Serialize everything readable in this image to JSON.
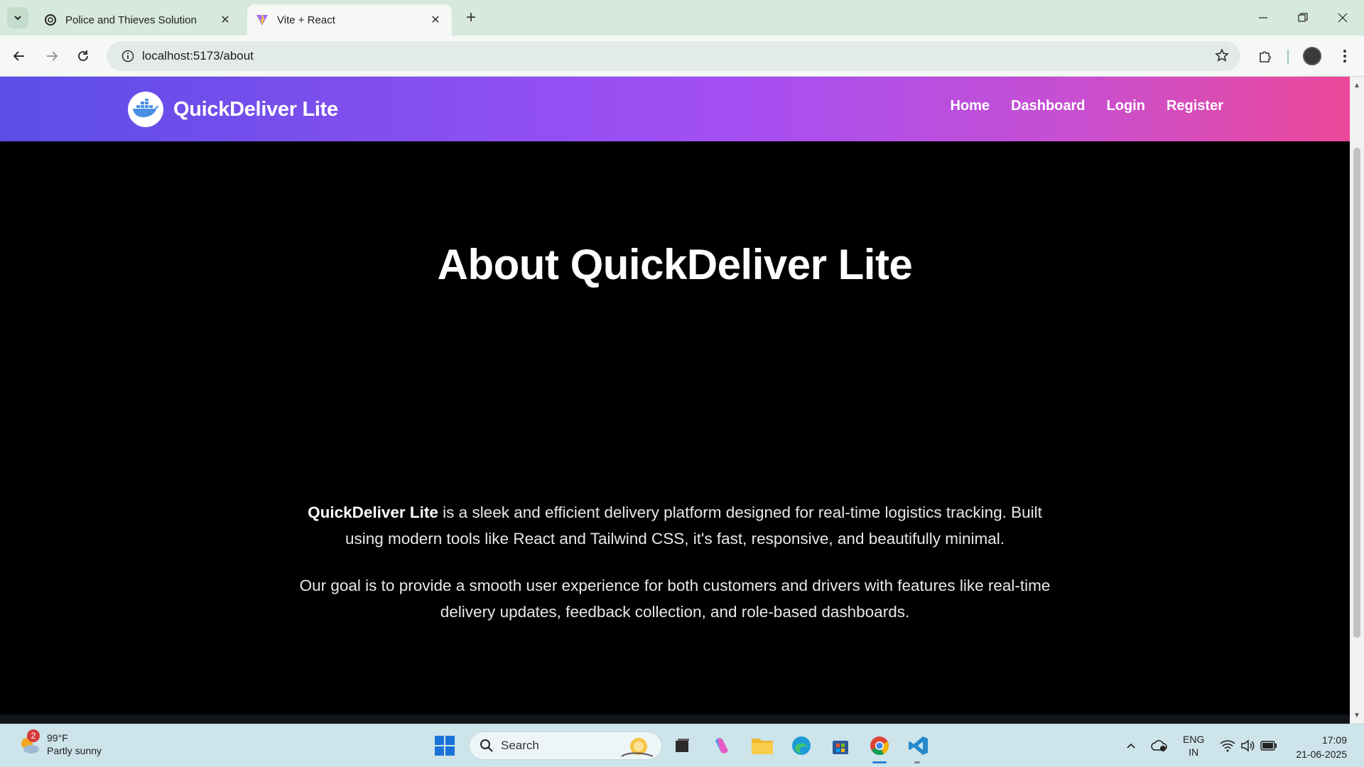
{
  "browser": {
    "tabs": [
      {
        "title": "Police and Thieves Solution",
        "active": false,
        "icon": "openai-icon"
      },
      {
        "title": "Vite + React",
        "active": true,
        "icon": "vite-icon"
      }
    ],
    "url": "localhost:5173/about"
  },
  "site": {
    "brand": "QuickDeliver Lite",
    "nav": [
      "Home",
      "Dashboard",
      "Login",
      "Register"
    ],
    "gradient_colors": [
      "#5b4ee6",
      "#a54ff3",
      "#ec4899"
    ]
  },
  "about": {
    "title": "About QuickDeliver Lite",
    "p1_strong": "QuickDeliver Lite",
    "p1_rest": " is a sleek and efficient delivery platform designed for real-time logistics tracking. Built using modern tools like React and Tailwind CSS, it's fast, responsive, and beautifully minimal.",
    "p2": "Our goal is to provide a smooth user experience for both customers and drivers with features like real-time delivery updates, feedback collection, and role-based dashboards."
  },
  "taskbar": {
    "weather_badge": "2",
    "temperature": "99°F",
    "condition": "Partly sunny",
    "search_placeholder": "Search",
    "lang_line1": "ENG",
    "lang_line2": "IN",
    "time": "17:09",
    "date": "21-06-2025"
  }
}
